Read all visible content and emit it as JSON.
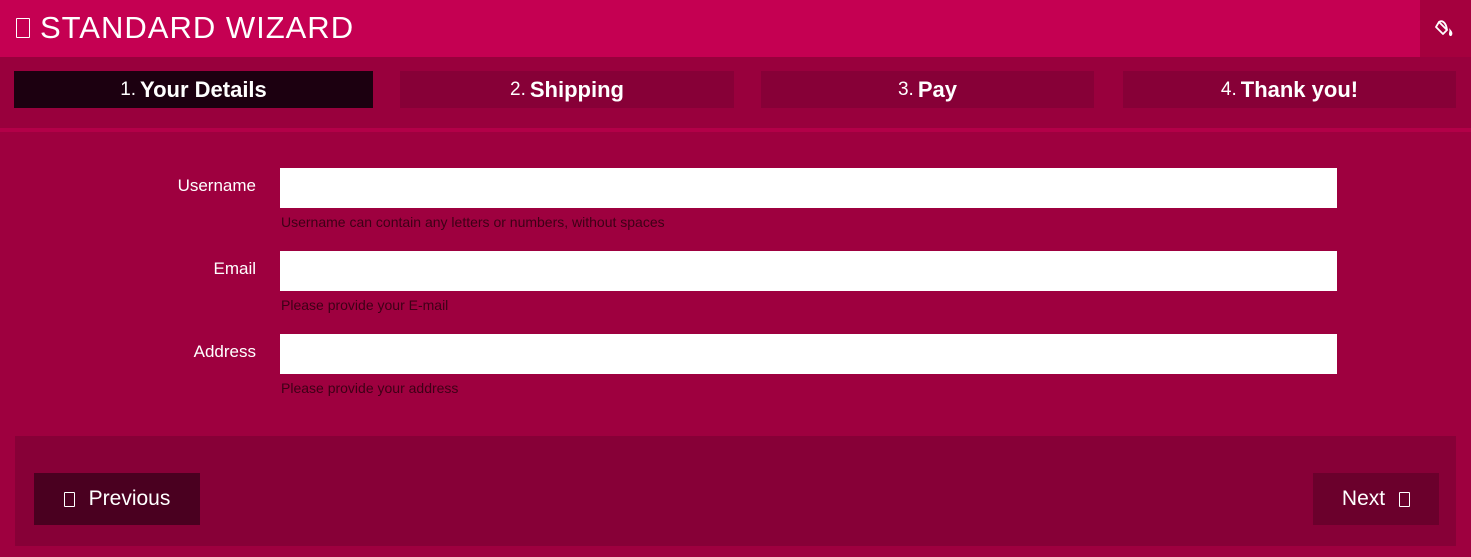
{
  "header": {
    "title": "STANDARD WIZARD",
    "title_icon": "missing-glyph-icon",
    "action_icon": "paint-bucket-icon"
  },
  "steps": [
    {
      "number": "1.",
      "label": "Your Details",
      "active": true
    },
    {
      "number": "2.",
      "label": "Shipping",
      "active": false
    },
    {
      "number": "3.",
      "label": "Pay",
      "active": false
    },
    {
      "number": "4.",
      "label": "Thank you!",
      "active": false
    }
  ],
  "form": {
    "username": {
      "label": "Username",
      "value": "",
      "hint": "Username can contain any letters or numbers, without spaces"
    },
    "email": {
      "label": "Email",
      "value": "",
      "hint": "Please provide your E-mail"
    },
    "address": {
      "label": "Address",
      "value": "",
      "hint": "Please provide your address"
    }
  },
  "footer": {
    "previous_label": "Previous",
    "previous_icon": "missing-glyph-icon",
    "next_label": "Next",
    "next_icon": "missing-glyph-icon"
  },
  "colors": {
    "header_bg": "#c50052",
    "page_bg": "#9e003f",
    "step_bg": "#870037",
    "step_active_bg": "#1c0010",
    "footer_bg": "#870037"
  }
}
